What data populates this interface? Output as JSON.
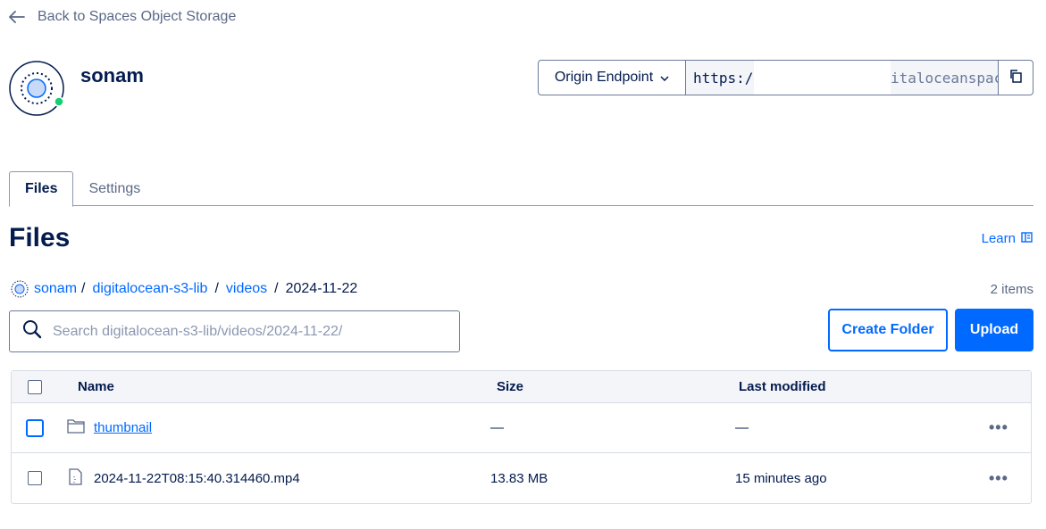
{
  "nav": {
    "back_label": "Back to Spaces Object Storage"
  },
  "space": {
    "name": "sonam",
    "status_color": "#15cd72"
  },
  "endpoint": {
    "select_label": "Origin Endpoint",
    "url_visible_start": "https:/",
    "url_visible_end": "italoceanspac"
  },
  "tabs": [
    {
      "label": "Files",
      "active": true
    },
    {
      "label": "Settings",
      "active": false
    }
  ],
  "page": {
    "title": "Files",
    "learn_label": "Learn"
  },
  "breadcrumb": {
    "root": "sonam",
    "parts": [
      "digitalocean-s3-lib",
      "videos"
    ],
    "current": "2024-11-22",
    "separator": "/"
  },
  "item_count": "2 items",
  "search": {
    "placeholder": "Search digitalocean-s3-lib/videos/2024-11-22/"
  },
  "actions": {
    "create_folder": "Create Folder",
    "upload": "Upload"
  },
  "table": {
    "columns": {
      "name": "Name",
      "size": "Size",
      "modified": "Last modified"
    },
    "rows": [
      {
        "type": "folder",
        "name": "thumbnail",
        "size": "—",
        "modified": "—",
        "icon": "folder-icon"
      },
      {
        "type": "file",
        "name": "2024-11-22T08:15:40.314460.mp4",
        "size": "13.83 MB",
        "modified": "15 minutes ago",
        "icon": "file-icon"
      }
    ],
    "more_label": "•••"
  },
  "colors": {
    "accent": "#0069ff",
    "text": "#031b4e",
    "muted": "#5b6987"
  }
}
